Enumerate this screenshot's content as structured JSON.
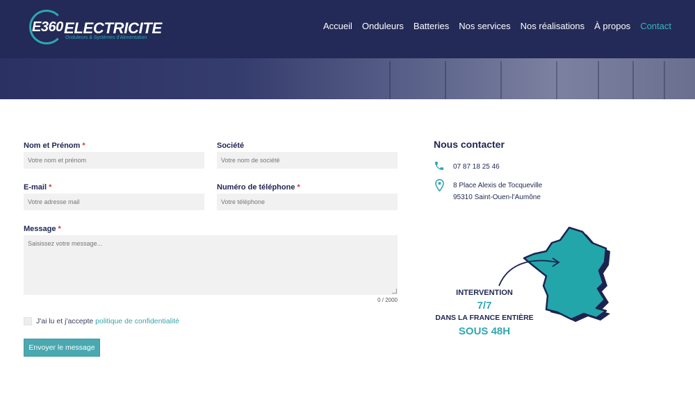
{
  "brand": {
    "mark": "E360",
    "name": "ELECTRICITE",
    "tagline": "Onduleurs & Systèmes d'Alimentation",
    "accent": "#2fa7b2",
    "header_bg": "#232a57"
  },
  "nav": {
    "items": [
      {
        "label": "Accueil"
      },
      {
        "label": "Onduleurs"
      },
      {
        "label": "Batteries"
      },
      {
        "label": "Nos services"
      },
      {
        "label": "Nos réalisations"
      },
      {
        "label": "À propos"
      },
      {
        "label": "Contact",
        "active": true
      }
    ]
  },
  "form": {
    "name": {
      "label": "Nom et Prénom",
      "required": "*",
      "placeholder": "Votre nom et prénom"
    },
    "company": {
      "label": "Société",
      "placeholder": "Votre nom de société"
    },
    "email": {
      "label": "E-mail",
      "required": "*",
      "placeholder": "Votre adresse mail"
    },
    "phone": {
      "label": "Numéro de téléphone",
      "required": "*",
      "placeholder": "Votre téléphone"
    },
    "message": {
      "label": "Message",
      "required": "*",
      "placeholder": "Saisissez votre message...",
      "counter": "0 / 2000"
    },
    "consent": {
      "text": "J'ai lu et j'accepte",
      "link": "politique de confidentialité",
      "checked": false
    },
    "submit_label": "Envoyer le message"
  },
  "contact": {
    "title": "Nous contacter",
    "phone": "07 87 18 25 46",
    "address_line1": "8 Place Alexis de Tocqueville",
    "address_line2": "95310 Saint-Ouen-l'Aumône",
    "icons": [
      "phone-icon",
      "map-pin-icon"
    ]
  },
  "promo": {
    "line1": "INTERVENTION",
    "line2": "7/7",
    "line3": "DANS LA FRANCE ENTIÈRE",
    "line4": "SOUS 48H"
  }
}
